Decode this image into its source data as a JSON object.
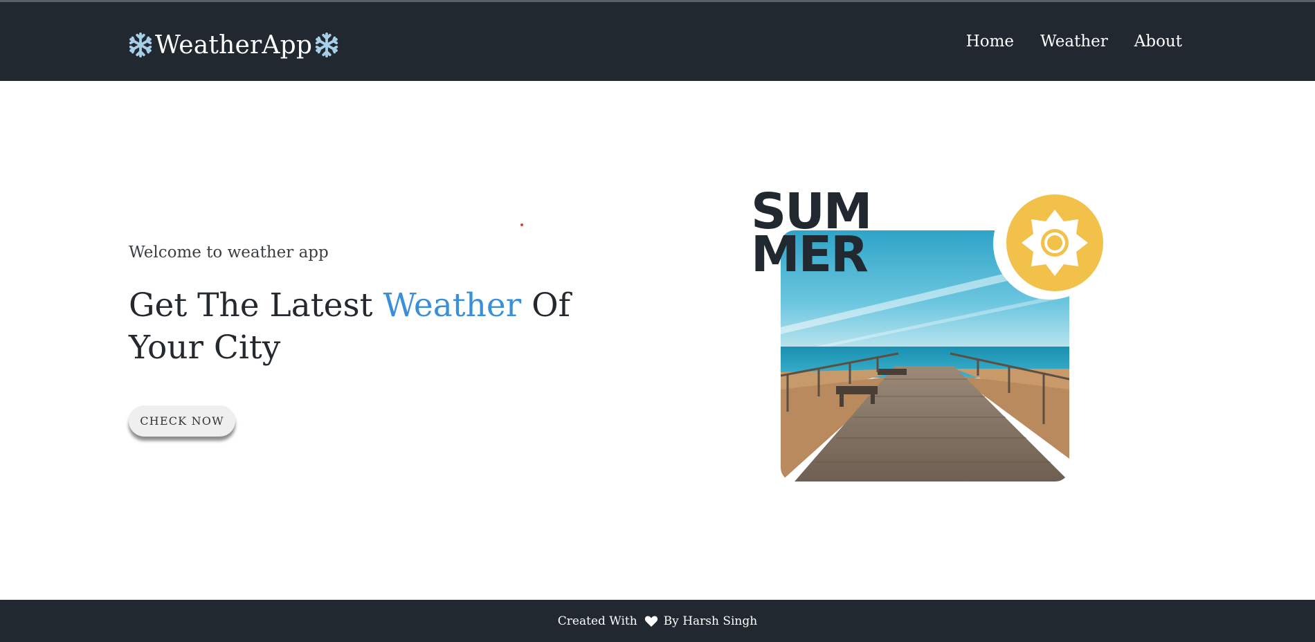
{
  "navbar": {
    "brand": "WeatherApp",
    "brand_icon": "snowflake-icon",
    "links": [
      "Home",
      "Weather",
      "About"
    ]
  },
  "hero": {
    "welcome": "Welcome to weather app",
    "headline_pre": "Get The Latest ",
    "headline_accent": "Weather",
    "headline_post": " Of Your City",
    "button_label": "CHECK NOW",
    "badge_line1": "SUM",
    "badge_line2": "MER",
    "badge_icon": "sun-icon",
    "image_icon": "boardwalk-beach-photo"
  },
  "footer": {
    "text_pre": "Created With",
    "text_post": "By Harsh Singh",
    "icon": "heart-icon"
  },
  "colors": {
    "navbar_bg": "#212830",
    "accent": "#3b8fd8",
    "sun": "#f2c14a",
    "snowflake": "#a8cfe8"
  }
}
